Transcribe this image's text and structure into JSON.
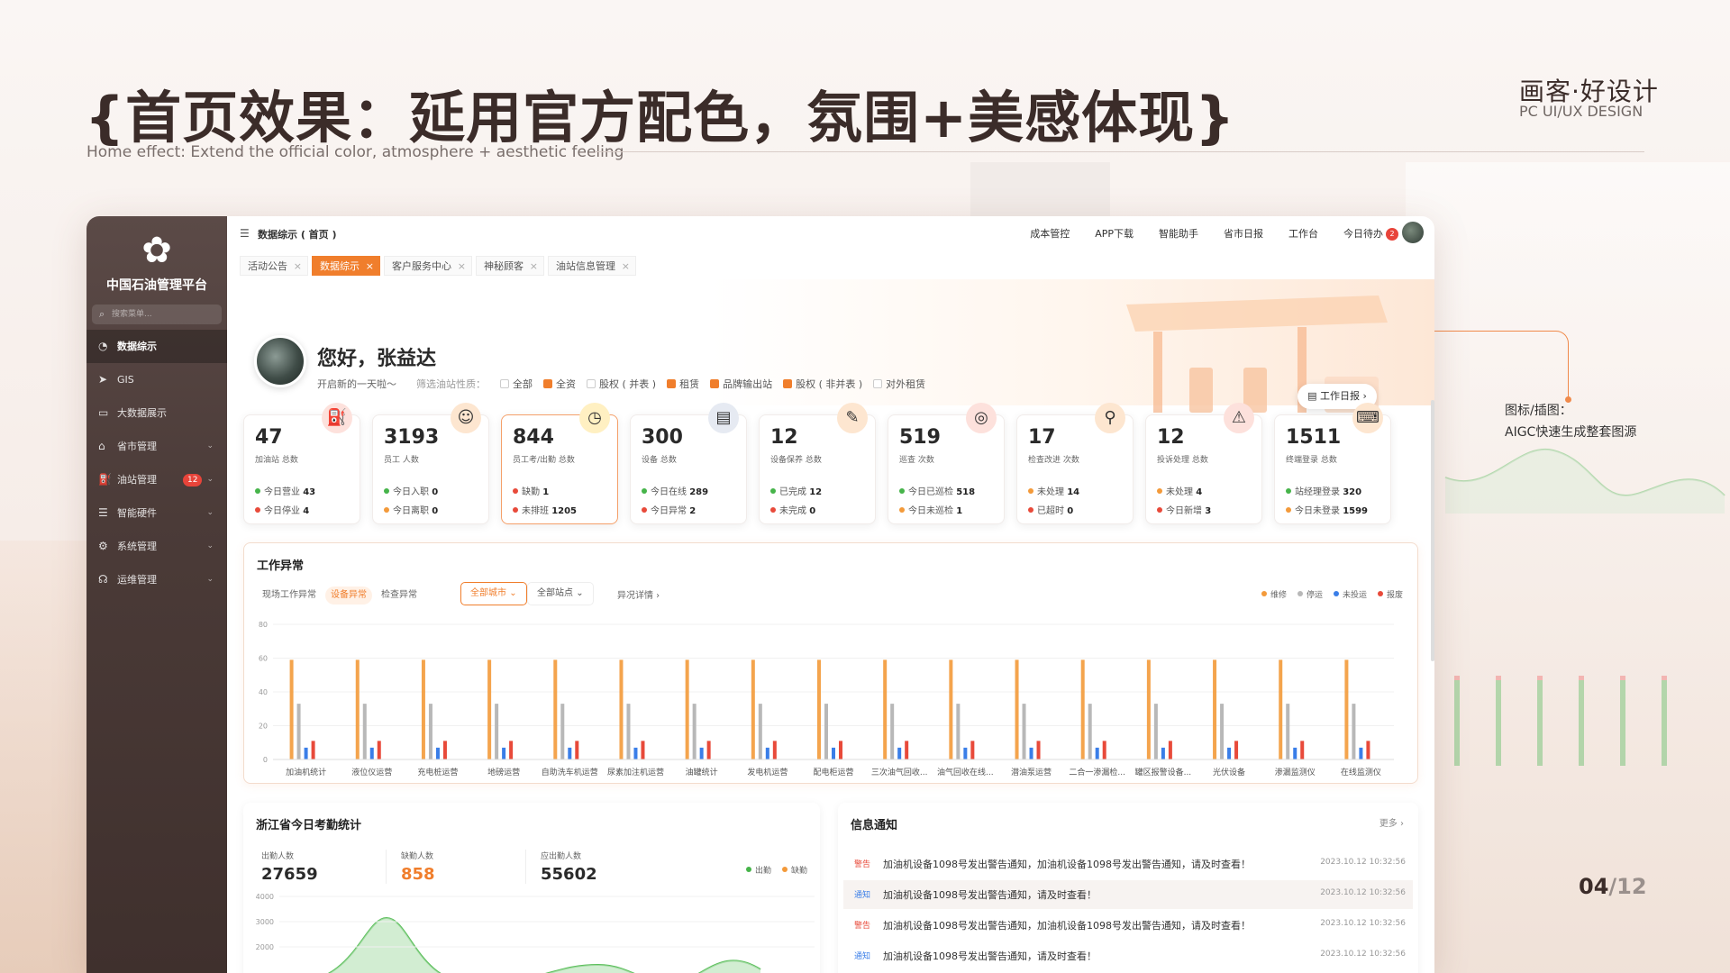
{
  "slide": {
    "title": "{首页效果：延用官方配色，氛围+美感体现}",
    "subtitle": "Home effect: Extend the official color, atmosphere + aesthetic feeling",
    "brand": "画客·好设计",
    "brand_sub": "PC UI/UX DESIGN",
    "page_current": "04",
    "page_total": "/12",
    "annotation_line1": "图标/插图：",
    "annotation_line2": "AIGC快速生成整套图源"
  },
  "app": {
    "name": "中国石油管理平台",
    "search_placeholder": "搜索菜单...",
    "nav": [
      {
        "label": "数据综示",
        "icon": "pie-chart-icon",
        "active": true
      },
      {
        "label": "GIS",
        "icon": "send-icon"
      },
      {
        "label": "大数据展示",
        "icon": "monitor-icon"
      },
      {
        "label": "省市管理",
        "icon": "map-icon",
        "expandable": true
      },
      {
        "label": "油站管理",
        "icon": "station-icon",
        "badge": "12",
        "expandable": true
      },
      {
        "label": "智能硬件",
        "icon": "server-icon",
        "expandable": true
      },
      {
        "label": "系统管理",
        "icon": "settings-icon",
        "expandable": true
      },
      {
        "label": "运维管理",
        "icon": "support-icon",
        "expandable": true
      }
    ],
    "breadcrumb": "数据综示 ( 首页 )",
    "top_links": [
      "成本管控",
      "APP下载",
      "智能助手",
      "省市日报",
      "工作台",
      "今日待办"
    ],
    "todo_badge": "2",
    "tabs": [
      {
        "label": "活动公告"
      },
      {
        "label": "数据综示",
        "active": true
      },
      {
        "label": "客户服务中心"
      },
      {
        "label": "神秘顾客"
      },
      {
        "label": "油站信息管理"
      }
    ]
  },
  "hero": {
    "greeting": "您好，张益达",
    "sub": "开启新的一天啦～",
    "filter_label": "筛选油站性质：",
    "filters": [
      {
        "label": "全部",
        "checked": false
      },
      {
        "label": "全资",
        "checked": true
      },
      {
        "label": "股权 ( 并表 )",
        "checked": false
      },
      {
        "label": "租赁",
        "checked": true
      },
      {
        "label": "品牌输出站",
        "checked": true
      },
      {
        "label": "股权 ( 非并表 )",
        "checked": true
      },
      {
        "label": "对外租赁",
        "checked": false
      }
    ],
    "daily_button": "工作日报"
  },
  "cards": [
    {
      "value": "47",
      "label": "加油站 总数",
      "icon": "fuel-pump-icon",
      "icon_bg": "#fde1dc",
      "r1_dot": "g",
      "r1_label": "今日营业",
      "r1_value": "43",
      "r2_dot": "r",
      "r2_label": "今日停业",
      "r2_value": "4"
    },
    {
      "value": "3193",
      "label": "员工 人数",
      "icon": "worker-icon",
      "icon_bg": "#fde6d0",
      "r1_dot": "g",
      "r1_label": "今日入职",
      "r1_value": "0",
      "r2_dot": "o",
      "r2_label": "今日离职",
      "r2_value": "0"
    },
    {
      "value": "844",
      "label": "员工考/出勤 总数",
      "icon": "clock-icon",
      "icon_bg": "#fff0c2",
      "r1_dot": "r",
      "r1_label": "缺勤",
      "r1_value": "1",
      "r2_dot": "r",
      "r2_label": "未排班",
      "r2_value": "1205",
      "highlight": true
    },
    {
      "value": "300",
      "label": "设备 总数",
      "icon": "device-icon",
      "icon_bg": "#e6eaf2",
      "r1_dot": "g",
      "r1_label": "今日在线",
      "r1_value": "289",
      "r2_dot": "r",
      "r2_label": "今日异常",
      "r2_value": "2"
    },
    {
      "value": "12",
      "label": "设备保养 总数",
      "icon": "wrench-icon",
      "icon_bg": "#fde6d0",
      "r1_dot": "g",
      "r1_label": "已完成",
      "r1_value": "12",
      "r2_dot": "r",
      "r2_label": "未完成",
      "r2_value": "0"
    },
    {
      "value": "519",
      "label": "巡查 次数",
      "icon": "target-icon",
      "icon_bg": "#fde1dc",
      "r1_dot": "g",
      "r1_label": "今日已巡检",
      "r1_value": "518",
      "r2_dot": "o",
      "r2_label": "今日未巡检",
      "r2_value": "1"
    },
    {
      "value": "17",
      "label": "检查改进 次数",
      "icon": "magnifier-icon",
      "icon_bg": "#fde6d0",
      "r1_dot": "o",
      "r1_label": "未处理",
      "r1_value": "14",
      "r2_dot": "r",
      "r2_label": "已超时",
      "r2_value": "0"
    },
    {
      "value": "12",
      "label": "投诉处理 总数",
      "icon": "warning-icon",
      "icon_bg": "#fde1dc",
      "r1_dot": "o",
      "r1_label": "未处理",
      "r1_value": "4",
      "r2_dot": "r",
      "r2_label": "今日新增",
      "r2_value": "3"
    },
    {
      "value": "1511",
      "label": "终端登录 总数",
      "icon": "terminal-icon",
      "icon_bg": "#fde6d0",
      "r1_dot": "g",
      "r1_label": "站经理登录",
      "r1_value": "320",
      "r2_dot": "o",
      "r2_label": "今日未登录",
      "r2_value": "1599"
    }
  ],
  "abnormal": {
    "title": "工作异常",
    "tabs": [
      {
        "label": "现场工作异常"
      },
      {
        "label": "设备异常",
        "active": true
      },
      {
        "label": "检查异常"
      }
    ],
    "city_select": "全部城市",
    "station_select": "全部站点",
    "detail": "异况详情",
    "legend": [
      {
        "label": "维修",
        "color": "#f39a3a"
      },
      {
        "label": "停运",
        "color": "#b8b8b8"
      },
      {
        "label": "未投运",
        "color": "#3a7ee8"
      },
      {
        "label": "报废",
        "color": "#e84a3a"
      }
    ]
  },
  "chart_data": {
    "type": "bar",
    "ylim": [
      0,
      80
    ],
    "yticks": [
      0,
      20,
      40,
      60,
      80
    ],
    "categories": [
      "加油机统计",
      "液位仪运营",
      "充电桩运营",
      "地磅运营",
      "自助洗车机运营",
      "尿素加注机运营",
      "油罐统计",
      "发电机运营",
      "配电柜运营",
      "三次油气回收...",
      "油气回收在线...",
      "潜油泵运营",
      "二合一渗漏检...",
      "罐区报警设备...",
      "光伏设备",
      "渗漏监测仪",
      "在线监测仪"
    ],
    "series": [
      {
        "name": "维修",
        "color": "#f39a3a",
        "values": [
          59,
          59,
          59,
          59,
          59,
          59,
          59,
          59,
          59,
          59,
          59,
          59,
          59,
          59,
          59,
          59,
          59
        ]
      },
      {
        "name": "停运",
        "color": "#b8b8b8",
        "values": [
          33,
          33,
          33,
          33,
          33,
          33,
          33,
          33,
          33,
          33,
          33,
          33,
          33,
          33,
          33,
          33,
          33
        ]
      },
      {
        "name": "未投运",
        "color": "#3a7ee8",
        "values": [
          7,
          7,
          7,
          7,
          7,
          7,
          7,
          7,
          7,
          7,
          7,
          7,
          7,
          7,
          7,
          7,
          7
        ]
      },
      {
        "name": "报废",
        "color": "#e84a3a",
        "values": [
          11,
          11,
          11,
          11,
          11,
          11,
          11,
          11,
          11,
          11,
          11,
          11,
          11,
          11,
          11,
          11,
          11
        ]
      }
    ]
  },
  "attendance": {
    "title": "浙江省今日考勤统计",
    "stats": [
      {
        "label": "出勤人数",
        "value": "27659"
      },
      {
        "label": "缺勤人数",
        "value": "858",
        "accent": true
      },
      {
        "label": "应出勤人数",
        "value": "55602"
      }
    ],
    "legend": [
      {
        "label": "出勤",
        "color": "#46b44a"
      },
      {
        "label": "缺勤",
        "color": "#f39a3a"
      }
    ],
    "yticks": [
      "4000",
      "3000",
      "2000"
    ]
  },
  "info": {
    "title": "信息通知",
    "more": "更多",
    "messages": [
      {
        "tag": "警告",
        "type": "warn",
        "text": "加油机设备1098号发出警告通知，加油机设备1098号发出警告通知，请及时查看！",
        "time": "2023.10.12 10:32:56"
      },
      {
        "tag": "通知",
        "type": "note",
        "text": "加油机设备1098号发出警告通知，请及时查看！",
        "time": "2023.10.12 10:32:56",
        "hover": true
      },
      {
        "tag": "警告",
        "type": "warn",
        "text": "加油机设备1098号发出警告通知，加油机设备1098号发出警告通知，请及时查看！",
        "time": "2023.10.12 10:32:56"
      },
      {
        "tag": "通知",
        "type": "note",
        "text": "加油机设备1098号发出警告通知，请及时查看！",
        "time": "2023.10.12 10:32:56"
      }
    ]
  }
}
